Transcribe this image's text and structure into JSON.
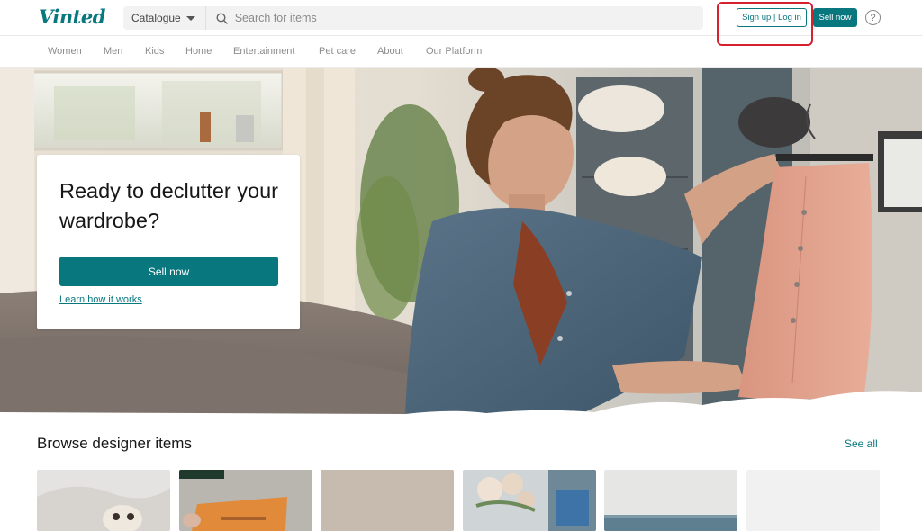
{
  "header": {
    "logo": "Vinted",
    "catalogue_label": "Catalogue",
    "search_placeholder": "Search for items",
    "signup_label": "Sign up | Log in",
    "sell_label": "Sell now",
    "help_glyph": "?"
  },
  "nav": {
    "items": [
      "Women",
      "Men",
      "Kids",
      "Home",
      "Entertainment",
      "Pet care",
      "About",
      "Our Platform"
    ]
  },
  "hero": {
    "title": "Ready to declutter your wardrobe?",
    "sell_label": "Sell now",
    "learn_label": "Learn how it works"
  },
  "browse": {
    "title": "Browse designer items",
    "see_all": "See all"
  },
  "colors": {
    "brand": "#09777e",
    "highlight": "#d61f2f"
  },
  "icons": {
    "search": "search-icon",
    "caret": "chevron-down-icon",
    "help": "help-icon"
  }
}
